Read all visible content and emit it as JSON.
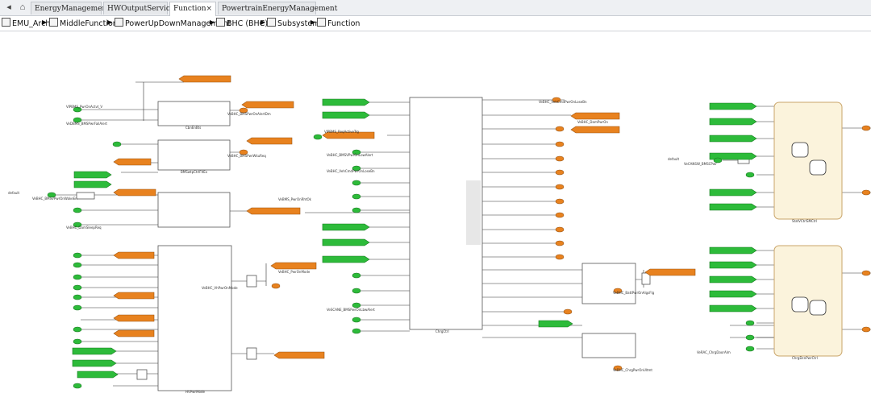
{
  "tabs": [
    {
      "label": "EnergyManagement",
      "active": false
    },
    {
      "label": "HWOutputService",
      "active": false
    },
    {
      "label": "Function",
      "active": true
    },
    {
      "label": "PowertrainEnergyManagement",
      "active": false
    }
  ],
  "breadcrumb": [
    "EMU_Arch",
    "MiddleFunction",
    "PowerUpDownManagement",
    "BHC (BHC)",
    "Subsystem",
    "Function"
  ],
  "diagram": {
    "subsystem_labels": [
      "CbnEnBts",
      "BMSwtpCtrlFltEx",
      "HVPwrMode",
      "ChrgCtrl",
      "StatVCtrlSMCtrl",
      "ChrgDcnPwrCtrl"
    ],
    "inport_labels": [
      "VlPBMS_PwrOnActvt_V",
      "VeDBMS_BMSPwrFailAlert",
      "VeBHC_BMSVPwrOnWakeEn",
      "VeBHC_DamSleepReq",
      "VlPBMS_ReqActiveTrg",
      "VeBHC_BMSVPwrOnLowAlert",
      "VeBHC_VehCmdPwrOnLoseBn",
      "VeSCANE_BMSPwrOnLbwAlert",
      "VeCANSW_BMSCPwr",
      "VeRAC_ChrgDoorAlm"
    ],
    "outport_labels": [
      "VeBHC_BMSPwrOnAlertDm",
      "VeBHC_BMSPwrWkuReq",
      "VeBHC_VhPwrOnMode",
      "VeBHC_VehCmdPwrOnLoseBn",
      "VeBHC_BattPwrOnAlgsFlg",
      "VeBHC_ChrgPwrOnUltmt"
    ],
    "goto_labels": [
      "VeBMS_PwrOnRhtOk",
      "VeBHC_DamPwrOn",
      "VeBHC_PwrOnMode"
    ],
    "from_labels": [
      "default",
      "default"
    ]
  }
}
